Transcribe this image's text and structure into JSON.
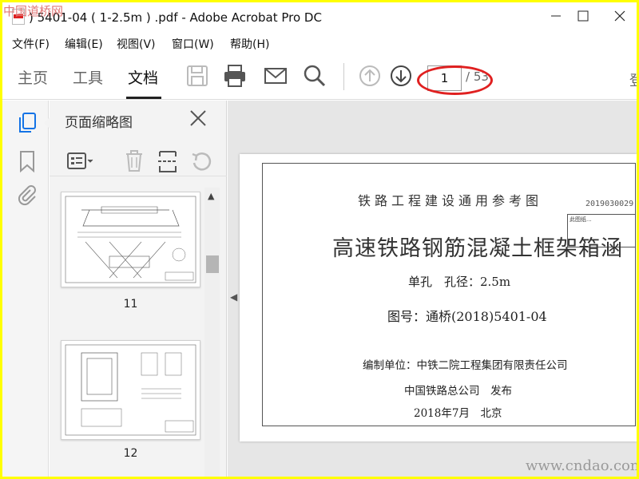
{
  "window": {
    "title": ") 5401-04 ( 1-2.5m ) .pdf - Adobe Acrobat Pro DC",
    "controls": [
      "minimize",
      "maximize",
      "close"
    ]
  },
  "menu": [
    "文件(F)",
    "编辑(E)",
    "视图(V)",
    "窗口(W)",
    "帮助(H)"
  ],
  "tabs": {
    "home": "主页",
    "tools": "工具",
    "document": "文档",
    "active": "文档"
  },
  "toolbar": {
    "icons": [
      "save-icon",
      "print-icon",
      "email-icon",
      "search-icon",
      "page-up-icon",
      "page-down-icon"
    ],
    "page_current": "1",
    "page_total": "/ 53",
    "sign_in_partial": "登"
  },
  "panel": {
    "title": "页面缩略图",
    "tools": [
      "options-menu-icon",
      "delete-icon",
      "extract-icon",
      "rotate-icon"
    ],
    "thumbnails": [
      {
        "number": "11"
      },
      {
        "number": "12"
      }
    ]
  },
  "leftrail": {
    "icons": [
      "pages-icon",
      "bookmark-icon",
      "attachment-icon"
    ]
  },
  "document": {
    "series": "铁路工程建设通用参考图",
    "code": "2019030029",
    "title": "高速铁路钢筋混凝土框架箱涵",
    "subtitle": "单孔　孔径：2.5m",
    "drawing_no": "图号：通桥(2018)5401-04",
    "compiler": "编制单位：中铁二院工程集团有限责任公司",
    "issuer": "中国铁路总公司　发布",
    "date": "2018年7月　北京",
    "stamp_text": "此图纸..."
  },
  "watermarks": {
    "top_left": "中国道桥网",
    "bottom_right": "www.cndao.com"
  },
  "colors": {
    "highlight": "#e02020",
    "watermark_top": "#e07878"
  }
}
